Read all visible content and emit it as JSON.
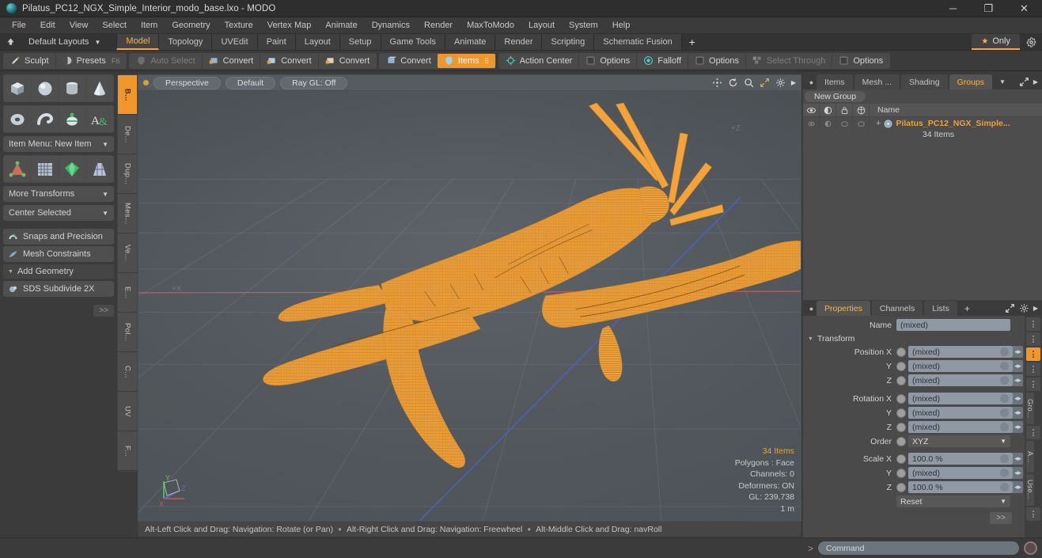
{
  "titlebar": {
    "title": "Pilatus_PC12_NGX_Simple_Interior_modo_base.lxo - MODO",
    "minimize": "─",
    "maximize": "❐",
    "close": "✕"
  },
  "menubar": {
    "items": [
      "File",
      "Edit",
      "View",
      "Select",
      "Item",
      "Geometry",
      "Texture",
      "Vertex Map",
      "Animate",
      "Dynamics",
      "Render",
      "MaxToModo",
      "Layout",
      "System",
      "Help"
    ]
  },
  "layoutbar": {
    "dropdown_label": "Default Layouts",
    "tabs": [
      {
        "label": "Model",
        "active": true
      },
      {
        "label": "Topology",
        "active": false
      },
      {
        "label": "UVEdit",
        "active": false
      },
      {
        "label": "Paint",
        "active": false
      },
      {
        "label": "Layout",
        "active": false
      },
      {
        "label": "Setup",
        "active": false
      },
      {
        "label": "Game Tools",
        "active": false
      },
      {
        "label": "Animate",
        "active": false
      },
      {
        "label": "Render",
        "active": false
      },
      {
        "label": "Scripting",
        "active": false
      },
      {
        "label": "Schematic Fusion",
        "active": false
      }
    ],
    "add_label": "+",
    "only_label": "Only"
  },
  "toolbar": {
    "groups": [
      {
        "buttons": [
          {
            "label": "Sculpt",
            "icon": "brush-icon",
            "state": "normal"
          },
          {
            "label": "Presets",
            "icon": "sphere-icon",
            "state": "normal",
            "hint": "F6"
          }
        ]
      },
      {
        "buttons": [
          {
            "label": "Auto Select",
            "icon": "shield-icon",
            "state": "dim"
          },
          {
            "label": "Convert",
            "icon": "convert-vertex-icon",
            "state": "normal"
          },
          {
            "label": "Convert",
            "icon": "convert-edge-icon",
            "state": "normal"
          },
          {
            "label": "Convert",
            "icon": "convert-polygon-icon",
            "state": "normal"
          }
        ]
      },
      {
        "buttons": [
          {
            "label": "Convert",
            "icon": "convert-item-icon",
            "state": "normal"
          },
          {
            "label": "Items",
            "icon": "items-icon",
            "state": "active",
            "hint": "5"
          }
        ]
      },
      {
        "buttons": [
          {
            "label": "Action Center",
            "icon": "action-center-icon",
            "state": "normal"
          },
          {
            "label": "Options",
            "icon": "checkbox-icon",
            "state": "normal"
          },
          {
            "label": "Falloff",
            "icon": "falloff-icon",
            "state": "normal"
          },
          {
            "label": "Options",
            "icon": "checkbox-icon",
            "state": "normal"
          },
          {
            "label": "Select Through",
            "icon": "select-through-icon",
            "state": "dim"
          },
          {
            "label": "Options",
            "icon": "checkbox-icon",
            "state": "normal"
          }
        ]
      }
    ]
  },
  "leftpanel": {
    "primitives_row1": [
      "cube-icon",
      "sphere-icon",
      "cylinder-icon",
      "cone-icon"
    ],
    "primitives_row2": [
      "torus-icon",
      "tube-icon",
      "teapot-icon",
      "text-icon"
    ],
    "item_menu": "Item Menu: New Item",
    "tools_row": [
      "mesh-ops-icon",
      "grid-icon",
      "gem-icon",
      "lattice-icon"
    ],
    "more_transforms": "More Transforms",
    "center_selected": "Center Selected",
    "snaps": "Snaps and Precision",
    "mesh_constraints": "Mesh Constraints",
    "add_geometry": "Add Geometry",
    "sds_subdivide": "SDS Subdivide 2X",
    "more_button": ">>",
    "vtabs": [
      {
        "label": "B...",
        "active": true
      },
      {
        "label": "De...",
        "active": false
      },
      {
        "label": "Dup...",
        "active": false
      },
      {
        "label": "Mes...",
        "active": false
      },
      {
        "label": "Ve...",
        "active": false
      },
      {
        "label": "E...",
        "active": false
      },
      {
        "label": "Pol...",
        "active": false
      },
      {
        "label": "C...",
        "active": false
      },
      {
        "label": "UV",
        "active": false
      },
      {
        "label": "F...",
        "active": false
      }
    ]
  },
  "viewport": {
    "projection": "Perspective",
    "shading": "Default",
    "raygl": "Ray GL: Off",
    "header_icons": [
      "pan-icon",
      "rotate-icon",
      "zoom-icon",
      "fit-icon",
      "gear-icon",
      "chevron-right-icon"
    ],
    "axis_label_z": "+Z",
    "axis_label_x": "+X",
    "gizmo_axes": [
      "X",
      "Y",
      "Z"
    ],
    "info": {
      "items": "34 Items",
      "polygons": "Polygons : Face",
      "channels": "Channels: 0",
      "deformers": "Deformers: ON",
      "gl": "GL: 239,738",
      "scale": "1 m"
    },
    "status": [
      "Alt-Left Click and Drag: Navigation: Rotate (or Pan)",
      "Alt-Right Click and Drag: Navigation: Freewheel",
      "Alt-Middle Click and Drag: navRoll"
    ],
    "mesh_color": "#f2a33c"
  },
  "rightpanel": {
    "top_tabs": [
      {
        "label": "Items",
        "active": false
      },
      {
        "label": "Mesh ...",
        "active": false
      },
      {
        "label": "Shading",
        "active": false
      },
      {
        "label": "Groups",
        "active": true
      }
    ],
    "new_group_label": "New Group",
    "list_columns": [
      "visibility-icon",
      "render-icon",
      "lock-icon",
      "wireframe-icon",
      "Name"
    ],
    "list_items": [
      {
        "name": "Pilatus_PC12_NGX_Simple...",
        "sub": "34 Items",
        "icon": "group-icon",
        "expand": "+"
      }
    ],
    "prop_tabs": [
      {
        "label": "Properties",
        "active": true
      },
      {
        "label": "Channels",
        "active": false
      },
      {
        "label": "Lists",
        "active": false
      }
    ],
    "prop_add": "+",
    "name_label": "Name",
    "name_value": "(mixed)",
    "transform_label": "Transform",
    "fields": [
      {
        "label": "Position X",
        "value": "(mixed)",
        "type": "num"
      },
      {
        "label": "Y",
        "value": "(mixed)",
        "type": "num"
      },
      {
        "label": "Z",
        "value": "(mixed)",
        "type": "num"
      },
      {
        "label": "Rotation X",
        "value": "(mixed)",
        "type": "num"
      },
      {
        "label": "Y",
        "value": "(mixed)",
        "type": "num"
      },
      {
        "label": "Z",
        "value": "(mixed)",
        "type": "num"
      },
      {
        "label": "Order",
        "value": "XYZ",
        "type": "select"
      },
      {
        "label": "Scale X",
        "value": "100.0 %",
        "type": "num"
      },
      {
        "label": "Y",
        "value": "(mixed)",
        "type": "num"
      },
      {
        "label": "Z",
        "value": "100.0 %",
        "type": "num"
      }
    ],
    "reset_label": "Reset",
    "more_button": ">>",
    "side_chips": [
      {
        "label": "",
        "active": false
      },
      {
        "label": "",
        "active": false
      },
      {
        "label": "",
        "active": true
      },
      {
        "label": "",
        "active": false
      },
      {
        "label": "",
        "active": false
      },
      {
        "label": "Gro...",
        "active": false
      },
      {
        "label": "",
        "active": false
      },
      {
        "label": "A...",
        "active": false
      },
      {
        "label": "Use...",
        "active": false
      },
      {
        "label": "",
        "active": false
      }
    ]
  },
  "commandbar": {
    "prompt": ">",
    "placeholder": "Command",
    "record_icon": "record-icon"
  },
  "colors": {
    "accent": "#f0962a",
    "accent_text": "#ffb13b",
    "mesh": "#f2a33c",
    "panel": "#3b3b3b",
    "viewport_bg": "#4c5256"
  }
}
